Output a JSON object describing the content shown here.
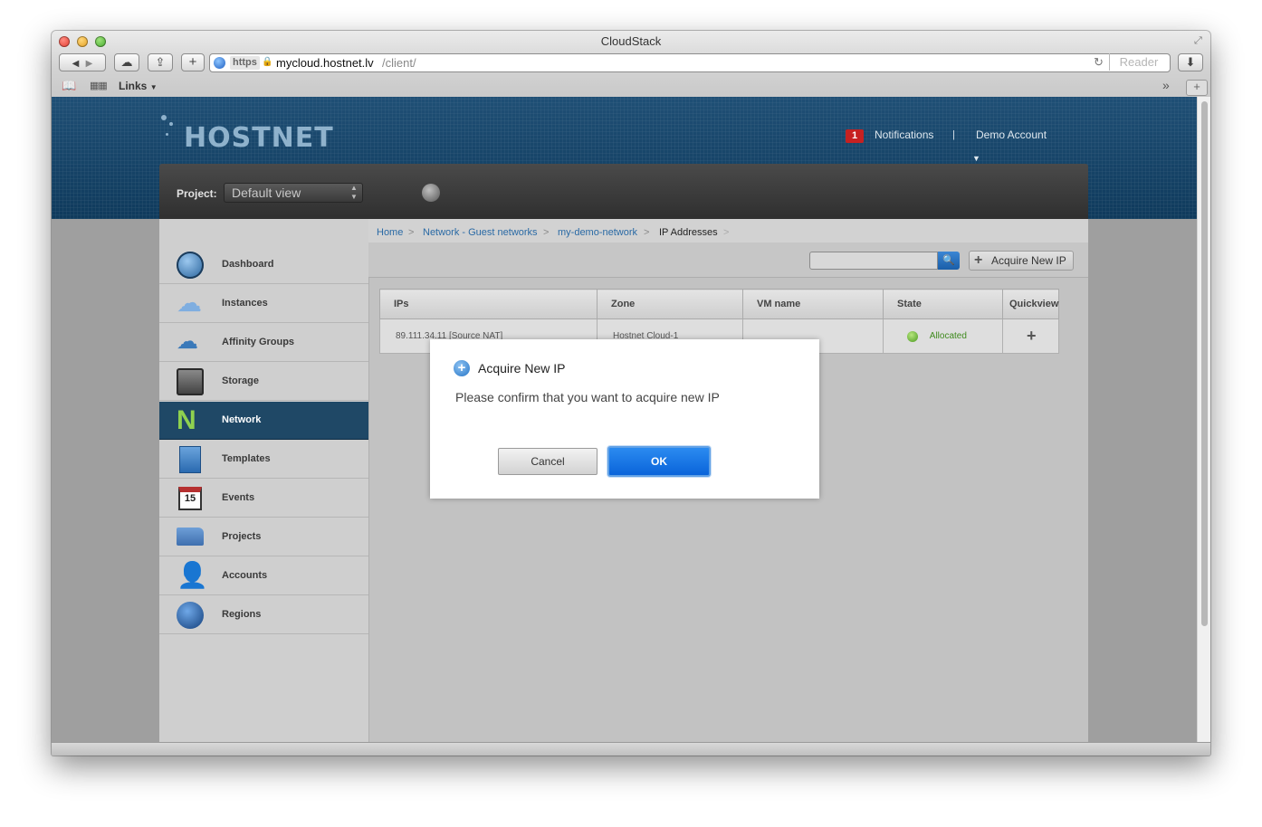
{
  "window": {
    "title": "CloudStack",
    "url_scheme": "https",
    "url_host": "mycloud.hostnet.lv",
    "url_path": "/client/",
    "reader_label": "Reader",
    "bookmarks_label": "Links"
  },
  "header": {
    "logo_text": "HOSTNET",
    "notifications_count": "1",
    "notifications_label": "Notifications",
    "separator": "|",
    "account_label": "Demo Account",
    "project_label": "Project:",
    "project_value": "Default view"
  },
  "sidebar": {
    "items": [
      {
        "label": "Dashboard",
        "icon": "dashboard-icon"
      },
      {
        "label": "Instances",
        "icon": "cloud-icon"
      },
      {
        "label": "Affinity Groups",
        "icon": "affinity-icon"
      },
      {
        "label": "Storage",
        "icon": "storage-icon"
      },
      {
        "label": "Network",
        "icon": "network-icon"
      },
      {
        "label": "Templates",
        "icon": "template-icon"
      },
      {
        "label": "Events",
        "icon": "calendar-icon",
        "badge": "15"
      },
      {
        "label": "Projects",
        "icon": "folder-icon"
      },
      {
        "label": "Accounts",
        "icon": "user-icon"
      },
      {
        "label": "Regions",
        "icon": "globe-icon"
      }
    ],
    "active_index": 4
  },
  "breadcrumb": {
    "items": [
      "Home",
      "Network - Guest networks",
      "my-demo-network",
      "IP Addresses"
    ],
    "separator": ">"
  },
  "toolbar": {
    "search_placeholder": "",
    "acquire_label": "Acquire New IP"
  },
  "table": {
    "headers": [
      "IPs",
      "Zone",
      "VM name",
      "State",
      "Quickview"
    ],
    "rows": [
      {
        "ip": "89.111.34.11 [Source NAT]",
        "zone": "Hostnet Cloud-1",
        "vm_name": "",
        "state": "Allocated",
        "quickview": "+"
      }
    ]
  },
  "dialog": {
    "title": "Acquire New IP",
    "message": "Please confirm that you want to acquire new IP",
    "cancel_label": "Cancel",
    "ok_label": "OK"
  },
  "colors": {
    "header_blue": "#0f3a5c",
    "active_nav": "#1f4866",
    "ok_button": "#0a64da",
    "allocated_green": "#3f8a1e",
    "notification_red": "#c62121"
  }
}
